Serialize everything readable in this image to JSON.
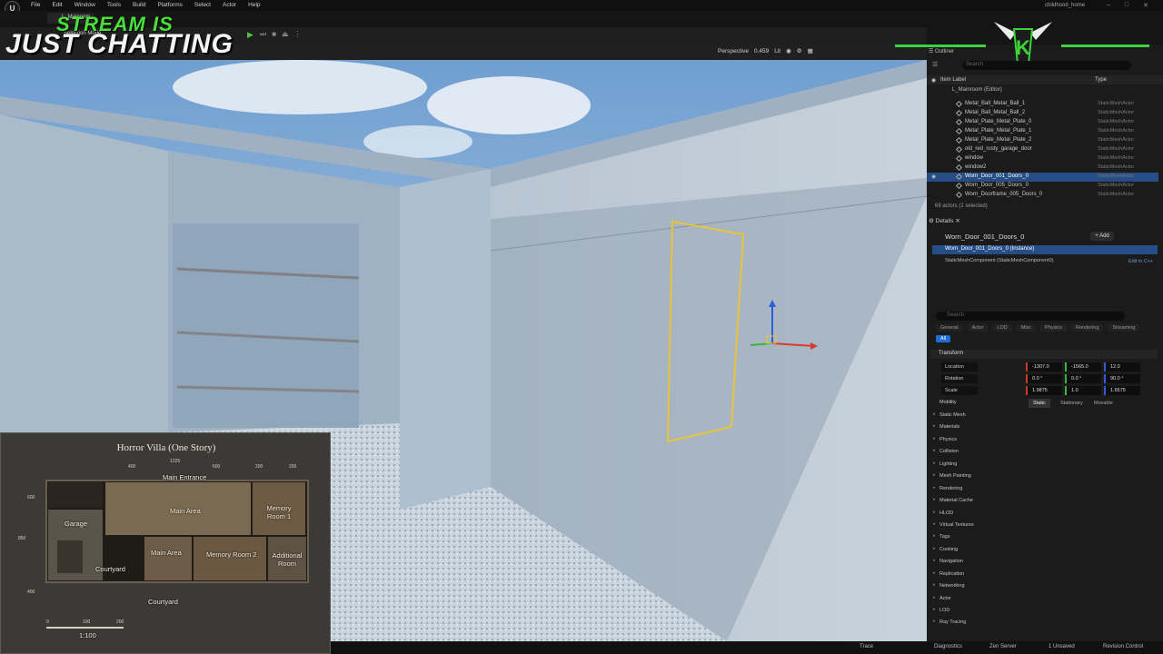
{
  "menubar": {
    "items": [
      "File",
      "Edit",
      "Window",
      "Tools",
      "Build",
      "Platforms",
      "Select",
      "Actor",
      "Help"
    ],
    "project": "childhood_home",
    "level_tab": "L_Mainoom"
  },
  "toolbar": {
    "selection_mode": "Selection Mode",
    "play_icon": "play-icon"
  },
  "viewport": {
    "perspective": "Perspective",
    "fov": "0.459",
    "lit": "Lit"
  },
  "overlay": {
    "line1": "STREAM IS",
    "line2": "JUST CHATTING"
  },
  "map": {
    "title": "Horror Villa (One Story)",
    "top_dims": [
      "1225",
      "400",
      "600",
      "200",
      "200"
    ],
    "main_entrance": "Main Entrance",
    "rooms": [
      "Garage",
      "Main Area",
      "Memory Room 1",
      "Main Area",
      "Memory Room 2",
      "Additional Room",
      "Courtyard",
      "Courtyard"
    ],
    "side_dims": [
      "600",
      "850",
      "400"
    ],
    "scale_ticks": [
      "0",
      "100",
      "200"
    ],
    "scale": "1:100"
  },
  "outliner": {
    "tab": "Outliner",
    "search_placeholder": "Search",
    "col_label": "Item Label",
    "col_type": "Type",
    "root": "L_Mainroom (Editor)",
    "rows": [
      {
        "name": "Metal_Ball_Metal_Ball_1",
        "type": "StaticMeshActor"
      },
      {
        "name": "Metal_Ball_Metal_Ball_2",
        "type": "StaticMeshActor"
      },
      {
        "name": "Metal_Plate_Metal_Plate_0",
        "type": "StaticMeshActor"
      },
      {
        "name": "Metal_Plate_Metal_Plate_1",
        "type": "StaticMeshActor"
      },
      {
        "name": "Metal_Plate_Metal_Plate_2",
        "type": "StaticMeshActor"
      },
      {
        "name": "old_red_rusty_garage_door",
        "type": "StaticMeshActor"
      },
      {
        "name": "window",
        "type": "StaticMeshActor"
      },
      {
        "name": "window2",
        "type": "StaticMeshActor"
      },
      {
        "name": "Worn_Door_001_Doors_0",
        "type": "StaticMeshActor",
        "selected": true
      },
      {
        "name": "Worn_Door_005_Doors_0",
        "type": "StaticMeshActor"
      },
      {
        "name": "Worn_Doorframe_005_Doors_0",
        "type": "StaticMeshActor"
      }
    ],
    "count": "69 actors (1 selected)"
  },
  "details": {
    "tab": "Details",
    "actor_name": "Worn_Door_001_Doors_0",
    "add_label": "+ Add",
    "instance": "Worn_Door_001_Doors_0 (Instance)",
    "component": "StaticMeshComponent (StaticMeshComponent0)",
    "edit_cpp": "Edit in C++",
    "search_placeholder": "Search",
    "categories": [
      "General",
      "Actor",
      "LOD",
      "Misc",
      "Physics",
      "Rendering",
      "Streaming",
      "All"
    ],
    "transform_label": "Transform",
    "location": {
      "label": "Location",
      "x": "-1307.0",
      "y": "-1565.0",
      "z": "12.0"
    },
    "rotation": {
      "label": "Rotation",
      "x": "0.0 °",
      "y": "0.0 °",
      "z": "90.0 °"
    },
    "scale": {
      "label": "Scale",
      "x": "1.9875",
      "y": "1.0",
      "z": "1.6575"
    },
    "mobility": {
      "label": "Mobility",
      "options": [
        "Static",
        "Stationary",
        "Movable"
      ]
    },
    "sections": [
      "Static Mesh",
      "Materials",
      "Physics",
      "Collision",
      "Lighting",
      "Mesh Painting",
      "Rendering",
      "Material Cache",
      "HLOD",
      "Virtual Textures",
      "Tags",
      "Cooking",
      "Navigation",
      "Replication",
      "Networking",
      "Actor",
      "LOD",
      "Ray Tracing"
    ]
  },
  "statusbar": {
    "trace": "Trace",
    "diagnostics": "Diagnostics",
    "zen": "Zen Server",
    "unsaved": "1 Unsaved",
    "revision": "Revision Control"
  },
  "colors": {
    "accent_green": "#3cd43a",
    "selection_blue": "#264e86",
    "active_tab_blue": "#1e6ed8"
  }
}
